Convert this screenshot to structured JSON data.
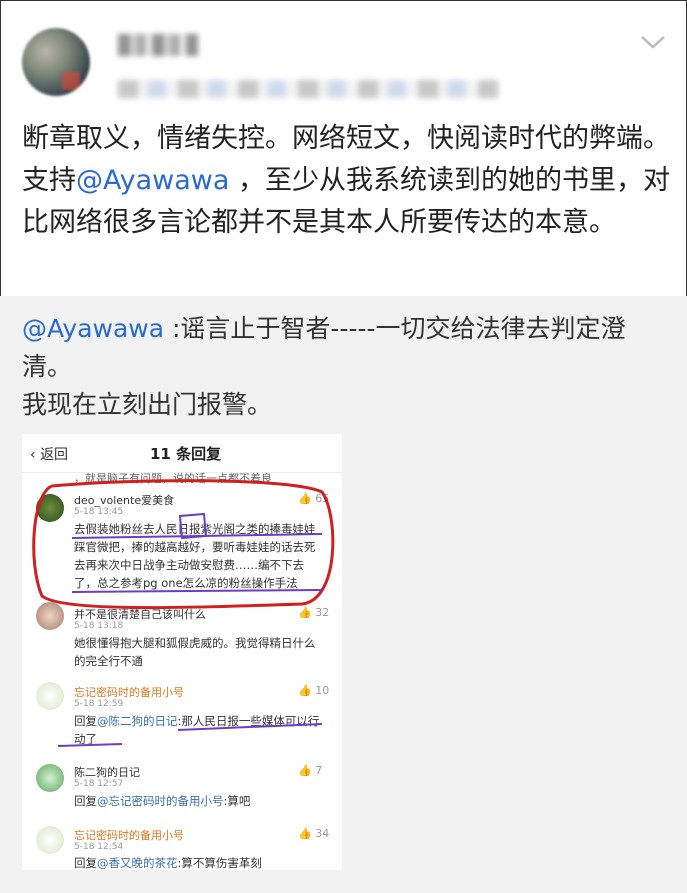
{
  "post": {
    "text_before": "断章取义，情绪失控。网络短文，快阅读时代的弊端。支持",
    "mention": "@Ayawawa",
    "text_after": " ，至少从我系统读到的她的书里，对比网络很多言论都并不是其本人所要传达的本意。"
  },
  "repost": {
    "mention": "@Ayawawa",
    "text_after": " :谣言止于智者-----一切交给法律去判定澄清。",
    "line2": "我现在立刻出门报警。"
  },
  "screenshot": {
    "back_label": "返回",
    "title": "11 条回复",
    "cut_text": "，就是脑子有问题，说的话一点都不着良",
    "comments": [
      {
        "user": "deo_volente爱美食",
        "time": "5-18 13:45",
        "likes": "65",
        "body": "去假装她粉丝去人民日报紫光阁之类的捧毒娃娃踩官微把，捧的越高越好，要听毒娃娃的话去死去再来次中日战争主动做安慰费……编不下去了，总之参考pg one怎么凉的粉丝操作手法"
      },
      {
        "user": "并不是很清楚自己该叫什么",
        "time": "5-18 13:18",
        "likes": "32",
        "body": "她很懂得抱大腿和狐假虎威的。我觉得精日什么的完全行不通"
      },
      {
        "user": "忘记密码时的备用小号",
        "time": "5-18 12:59",
        "likes": "10",
        "reply_prefix": "回复",
        "reply_to": "@陈二狗的日记",
        "body": ":那人民日报一些媒体可以行动了"
      },
      {
        "user": "陈二狗的日记",
        "time": "5-18 12:57",
        "likes": "7",
        "reply_prefix": "回复",
        "reply_to": "@忘记密码时的备用小号",
        "body": ":算吧"
      },
      {
        "user": "忘记密码时的备用小号",
        "time": "5-18 12:54",
        "likes": "34",
        "reply_prefix": "回复",
        "reply_to": "@香又晚的茶花",
        "body": ":算不算伤害革刻"
      }
    ]
  },
  "icons": {
    "chevron": "chevron-down-icon",
    "like": "thumbs-up-icon",
    "back": "chevron-left-icon"
  },
  "colors": {
    "mention": "#2a6ad1",
    "annotation_red": "#d11f1f",
    "annotation_purple": "#6a3fc4"
  }
}
